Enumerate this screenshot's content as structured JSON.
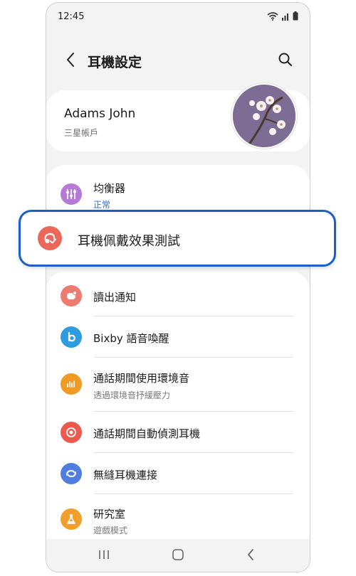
{
  "status": {
    "time": "12:45"
  },
  "header": {
    "title": "耳機設定"
  },
  "account": {
    "name": "Adams John",
    "subtitle": "三星帳戶"
  },
  "equalizer": {
    "label": "均衡器",
    "value": "正常"
  },
  "highlight": {
    "label": "耳機佩戴效果測試"
  },
  "items": [
    {
      "label": "讀出通知"
    },
    {
      "label": "Bixby 語音喚醒"
    },
    {
      "label": "通話期間使用環境音",
      "sub": "透過環境音抒緩壓力"
    },
    {
      "label": "通話期間自動偵測耳機"
    },
    {
      "label": "無縫耳機連接"
    },
    {
      "label": "研究室",
      "sub": "遊戲模式"
    }
  ],
  "colors": {
    "accent_blue": "#1d5fc9",
    "eq_icon": "#b57ad6",
    "fit_test_icon": "#ec6759",
    "notify_icon": "#ef7a70",
    "bixby_icon": "#2f9be0",
    "ambient_icon": "#f09a26",
    "detect_icon": "#ea5a4e",
    "seamless_icon": "#4f7ee0",
    "labs_icon": "#f0a02a",
    "link_text": "#2b6ad8"
  }
}
